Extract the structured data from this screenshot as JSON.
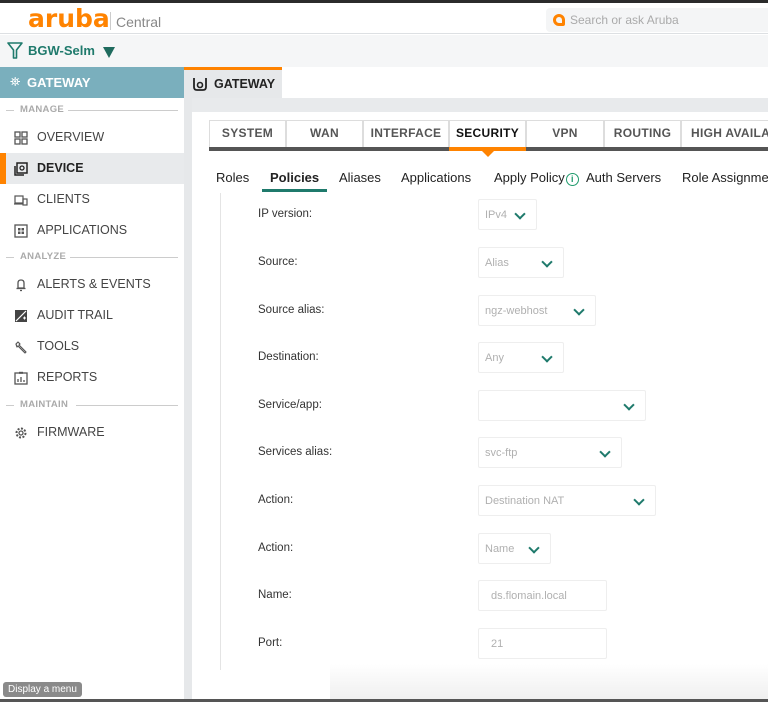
{
  "app": {
    "brand": "aruba",
    "product": "Central",
    "search_placeholder": "Search or ask Aruba",
    "brand_color": "#ff8300",
    "accent_color": "#1f7a6c"
  },
  "filter": {
    "label": "BGW-Selm",
    "icon": "funnel-icon"
  },
  "sidebar": {
    "header": {
      "label": "GATEWAY",
      "icon": "gateway-icon"
    },
    "sections": [
      {
        "label": "MANAGE"
      },
      {
        "label": "ANALYZE"
      },
      {
        "label": "MAINTAIN"
      }
    ],
    "items": [
      {
        "label": "OVERVIEW",
        "icon": "grid-icon",
        "section": "MANAGE",
        "active": false
      },
      {
        "label": "DEVICE",
        "icon": "device-icon",
        "section": "MANAGE",
        "active": true
      },
      {
        "label": "CLIENTS",
        "icon": "clients-icon",
        "section": "MANAGE",
        "active": false
      },
      {
        "label": "APPLICATIONS",
        "icon": "applications-icon",
        "section": "MANAGE",
        "active": false
      },
      {
        "label": "ALERTS & EVENTS",
        "icon": "bell-icon",
        "section": "ANALYZE",
        "active": false
      },
      {
        "label": "AUDIT TRAIL",
        "icon": "audit-icon",
        "section": "ANALYZE",
        "active": false
      },
      {
        "label": "TOOLS",
        "icon": "wrench-icon",
        "section": "ANALYZE",
        "active": false
      },
      {
        "label": "REPORTS",
        "icon": "report-icon",
        "section": "ANALYZE",
        "active": false
      },
      {
        "label": "FIRMWARE",
        "icon": "gear-icon",
        "section": "MAINTAIN",
        "active": false
      }
    ],
    "tooltip": "Display a menu"
  },
  "main": {
    "context_tab": {
      "label": "GATEWAY",
      "icon": "gateway-device-icon"
    },
    "tabs": [
      {
        "label": "SYSTEM",
        "active": false
      },
      {
        "label": "WAN",
        "active": false
      },
      {
        "label": "INTERFACE",
        "active": false
      },
      {
        "label": "SECURITY",
        "active": true
      },
      {
        "label": "VPN",
        "active": false
      },
      {
        "label": "ROUTING",
        "active": false
      },
      {
        "label": "HIGH AVAILA",
        "active": false
      }
    ],
    "subtabs": [
      {
        "label": "Roles",
        "active": false
      },
      {
        "label": "Policies",
        "active": true
      },
      {
        "label": "Aliases",
        "active": false
      },
      {
        "label": "Applications",
        "active": false
      },
      {
        "label": "Apply Policy",
        "active": false,
        "info": "i"
      },
      {
        "label": "Auth Servers",
        "active": false
      },
      {
        "label": "Role Assignmen",
        "active": false
      }
    ],
    "form": [
      {
        "label": "IP version:",
        "type": "select",
        "value": "IPv4"
      },
      {
        "label": "Source:",
        "type": "select",
        "value": "Alias"
      },
      {
        "label": "Source alias:",
        "type": "select",
        "value": "ngz-webhost"
      },
      {
        "label": "Destination:",
        "type": "select",
        "value": "Any"
      },
      {
        "label": "Service/app:",
        "type": "select",
        "value": ""
      },
      {
        "label": "Services alias:",
        "type": "select",
        "value": "svc-ftp"
      },
      {
        "label": "Action:",
        "type": "select",
        "value": "Destination NAT"
      },
      {
        "label": "Action:",
        "type": "select",
        "value": "Name"
      },
      {
        "label": "Name:",
        "type": "text",
        "value": "ds.flomain.local"
      },
      {
        "label": "Port:",
        "type": "text",
        "value": "21"
      }
    ]
  }
}
